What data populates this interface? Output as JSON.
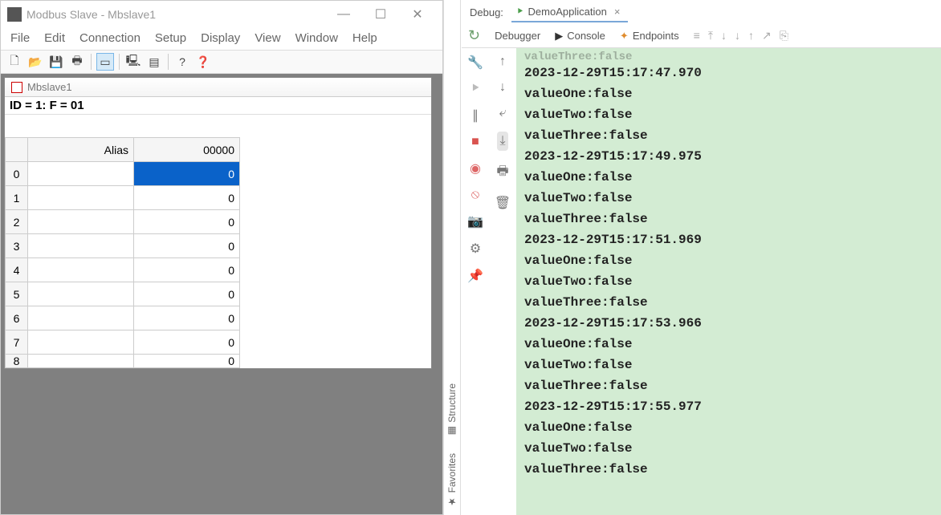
{
  "modbus": {
    "title": "Modbus Slave - Mbslave1",
    "menu": [
      "File",
      "Edit",
      "Connection",
      "Setup",
      "Display",
      "View",
      "Window",
      "Help"
    ],
    "child_title": "Mbslave1",
    "status": "ID = 1: F = 01",
    "col_alias": "Alias",
    "col_value": "00000",
    "rows": [
      {
        "idx": "0",
        "alias": "",
        "val": "0",
        "selected": true
      },
      {
        "idx": "1",
        "alias": "",
        "val": "0"
      },
      {
        "idx": "2",
        "alias": "",
        "val": "0"
      },
      {
        "idx": "3",
        "alias": "",
        "val": "0"
      },
      {
        "idx": "4",
        "alias": "",
        "val": "0"
      },
      {
        "idx": "5",
        "alias": "",
        "val": "0"
      },
      {
        "idx": "6",
        "alias": "",
        "val": "0"
      },
      {
        "idx": "7",
        "alias": "",
        "val": "0"
      },
      {
        "idx": "8",
        "alias": "",
        "val": "0",
        "cutoff": true
      }
    ]
  },
  "ide": {
    "debug_label": "Debug:",
    "app_tab": "DemoApplication",
    "tabs": {
      "debugger": "Debugger",
      "console": "Console",
      "endpoints": "Endpoints"
    },
    "side_labels": {
      "structure": "Structure",
      "favorites": "Favorites"
    },
    "console": [
      "valueThree:false",
      "2023-12-29T15:17:47.970",
      "valueOne:false",
      "valueTwo:false",
      "valueThree:false",
      "2023-12-29T15:17:49.975",
      "valueOne:false",
      "valueTwo:false",
      "valueThree:false",
      "2023-12-29T15:17:51.969",
      "valueOne:false",
      "valueTwo:false",
      "valueThree:false",
      "2023-12-29T15:17:53.966",
      "valueOne:false",
      "valueTwo:false",
      "valueThree:false",
      "2023-12-29T15:17:55.977",
      "valueOne:false",
      "valueTwo:false",
      "valueThree:false"
    ]
  }
}
